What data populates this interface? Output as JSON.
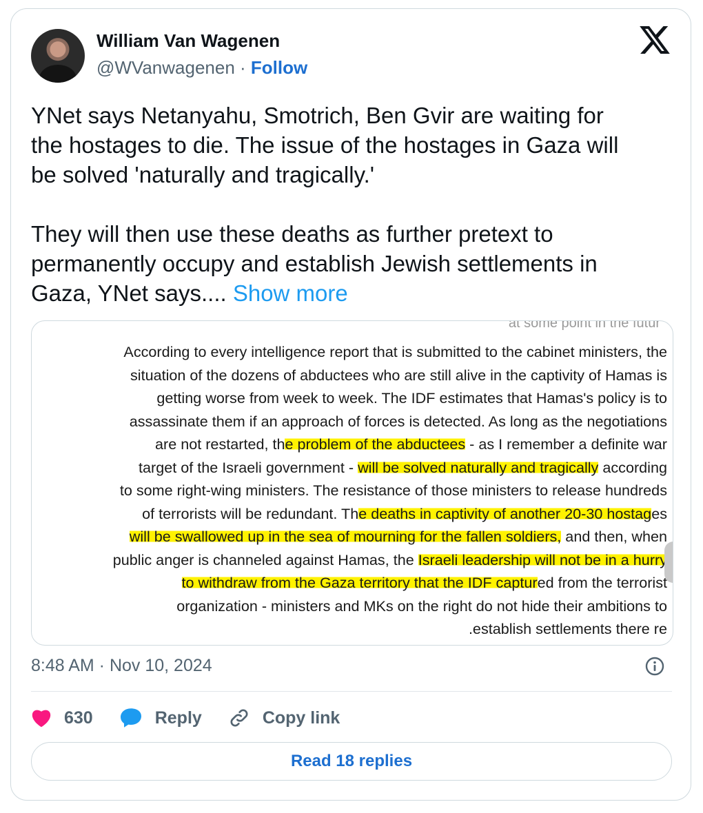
{
  "author": {
    "name": "William Van Wagenen",
    "handle": "@WVanwagenen",
    "separator": " · ",
    "follow_label": "Follow"
  },
  "tweet": {
    "text": "YNet says Netanyahu, Smotrich, Ben Gvir are waiting for\nthe hostages to die. The issue of the hostages in Gaza will\nbe solved 'naturally and tragically.'\n\nThey will then use these deaths as further pretext to\npermanently occupy and establish Jewish settlements in\nGaza, YNet says.... ",
    "show_more_label": "Show more"
  },
  "media": {
    "lines": [
      [
        "According to every intelligence report that is submitted to the cabinet ministers, the"
      ],
      [
        "situation of the dozens of abductees who are still alive in the captivity of Hamas is"
      ],
      [
        "getting worse from week to week. The IDF estimates that Hamas's policy is to"
      ],
      [
        "assassinate them if an approach of forces is detected. As long as the negotiations"
      ],
      [
        "are not restarted, th",
        "e problem of the abductees",
        " - as I remember a definite war"
      ],
      [
        "target of the Israeli government - ",
        "will be solved naturally and tragically",
        " according"
      ],
      [
        "to some right-wing ministers. The resistance of those ministers to release hundreds"
      ],
      [
        "of terrorists will be redundant. Th",
        "e deaths in captivity of another 20-30 hostag",
        "es"
      ],
      [
        "",
        "will be swallowed up in the sea of mourning for the fallen soldiers,",
        " and then, when"
      ],
      [
        "public anger is channeled against Hamas, the ",
        "Israeli leadership will not be in a hurry"
      ],
      [
        "",
        "to withdraw from the Gaza territory that the IDF captur",
        "ed from the terrorist"
      ],
      [
        "organization - ministers and MKs on the right do not hide their ambitions to"
      ],
      [
        ".establish settlements there re"
      ]
    ]
  },
  "meta": {
    "timestamp": "8:48 AM · Nov 10, 2024"
  },
  "actions": {
    "likes_count": "630",
    "reply_label": "Reply",
    "copy_link_label": "Copy link",
    "read_replies_label": "Read 18 replies"
  },
  "colors": {
    "accent": "#1d9bf0",
    "follow": "#1d6fd0",
    "like": "#f91880",
    "highlight": "#fff200"
  },
  "icons": [
    "x-logo-icon",
    "info-icon",
    "heart-icon",
    "reply-bubble-icon",
    "link-icon"
  ]
}
